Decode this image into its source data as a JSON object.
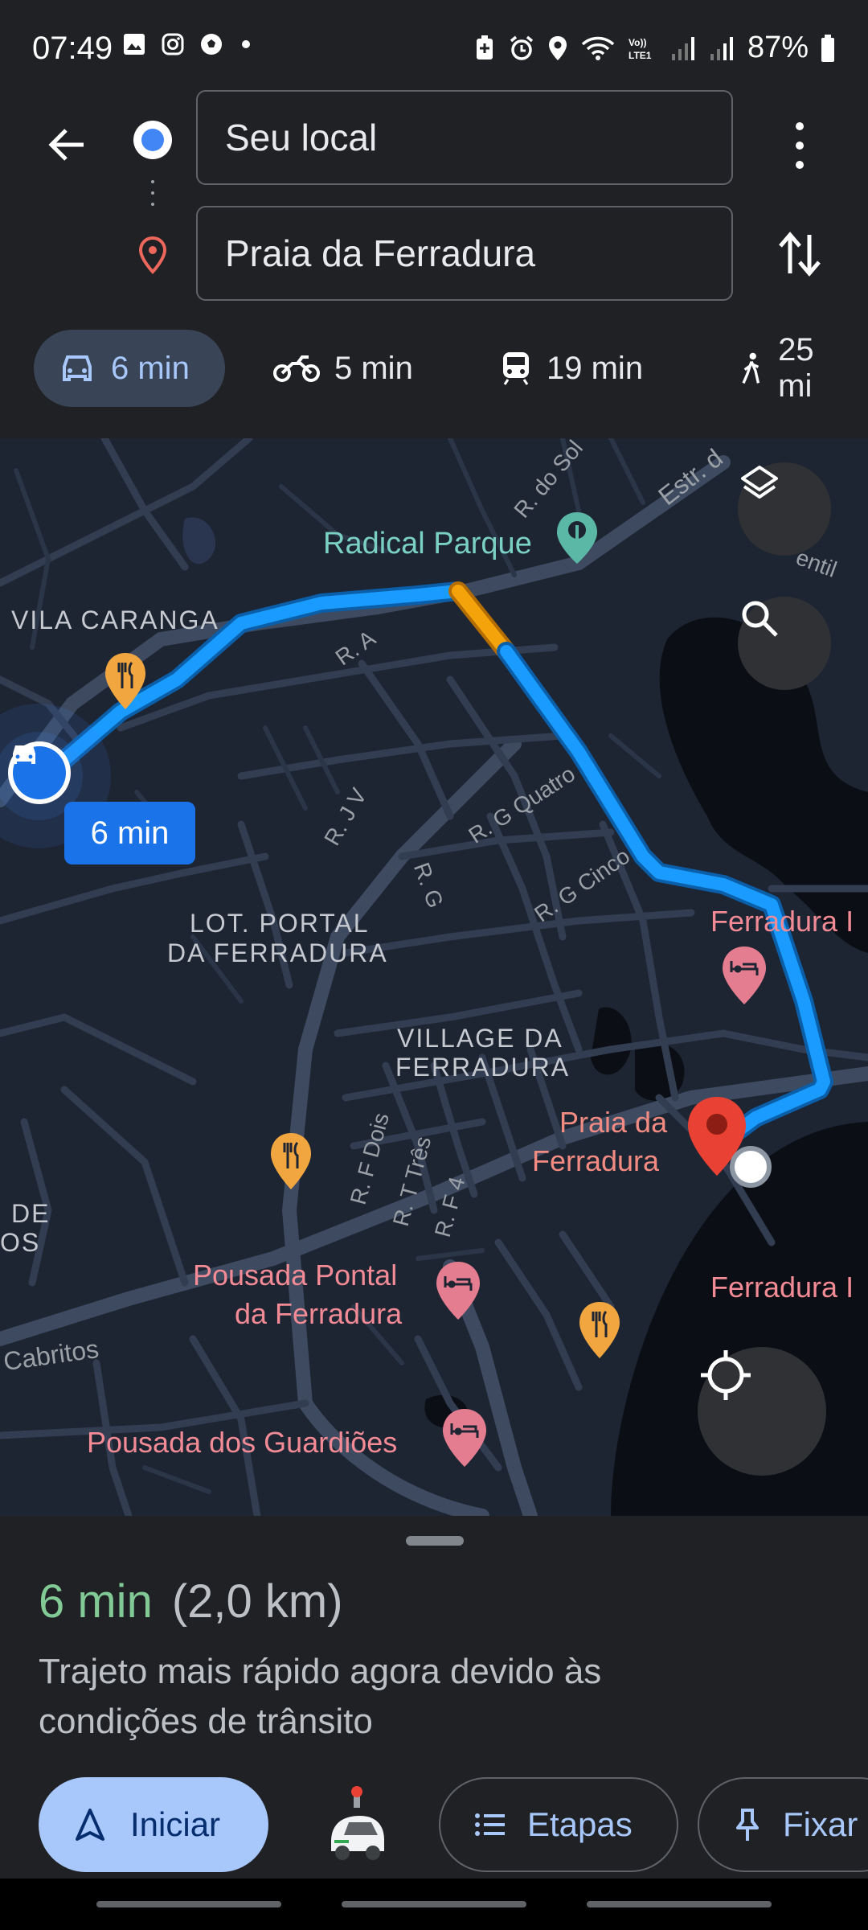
{
  "status_bar": {
    "time": "07:49",
    "battery": "87%",
    "left_icons": [
      "gallery-icon",
      "instagram-icon",
      "soccer-icon",
      "dot-icon"
    ],
    "right_icons": [
      "battery-saver-icon",
      "alarm-icon",
      "location-icon",
      "wifi-icon",
      "volte-icon",
      "signal-icon",
      "signal-icon",
      "battery-icon"
    ]
  },
  "directions": {
    "origin": "Seu local",
    "destination": "Praia da Ferradura"
  },
  "modes": [
    {
      "icon": "car-icon",
      "label": "6 min",
      "active": true
    },
    {
      "icon": "motorcycle-icon",
      "label": "5 min",
      "active": false
    },
    {
      "icon": "transit-icon",
      "label": "19 min",
      "active": false
    },
    {
      "icon": "walk-icon",
      "label": "25 mi",
      "active": false
    }
  ],
  "map": {
    "eta_badge": "6 min",
    "labels": {
      "radical_parque": "Radical Parque",
      "vila_caranga": "VILA CARANGA",
      "lot_portal_1": "LOT. PORTAL",
      "lot_portal_2": "DA FERRADURA",
      "village_1": "VILLAGE DA",
      "village_2": "FERRADURA",
      "praia_1": "Praia da",
      "praia_2": "Ferradura",
      "ferradura_top": "Ferradura I",
      "ferradura_bottom": "Ferradura I",
      "pousada_pontal_1": "Pousada Pontal",
      "pousada_pontal_2": "da Ferradura",
      "pousada_guardioes": "Pousada dos Guardiões",
      "cabritos": "Cabritos",
      "de": "DE",
      "os": "OS",
      "r_do_sol": "R. do Sol",
      "estr": "Estr. d",
      "r_a": "R. A",
      "r_j_v": "R. J V",
      "r_g_quatro": "R. G Quatro",
      "r_g": "R. G",
      "r_g_cinco": "R. G Cinco",
      "r_f_dois": "R. F Dois",
      "r_t_tres": "R. T Três",
      "r_f_4": "R. F 4",
      "entil": "entil"
    }
  },
  "sheet": {
    "duration": "6 min",
    "distance": "(2,0 km)",
    "description": "Trajeto mais rápido agora devido às condições de trânsito",
    "start_label": "Iniciar",
    "steps_label": "Etapas",
    "pin_label": "Fixar"
  },
  "colors": {
    "route": "#1a9bff",
    "traffic": "#f4a30a",
    "accent": "#a8c7fa",
    "duration": "#81c995"
  }
}
